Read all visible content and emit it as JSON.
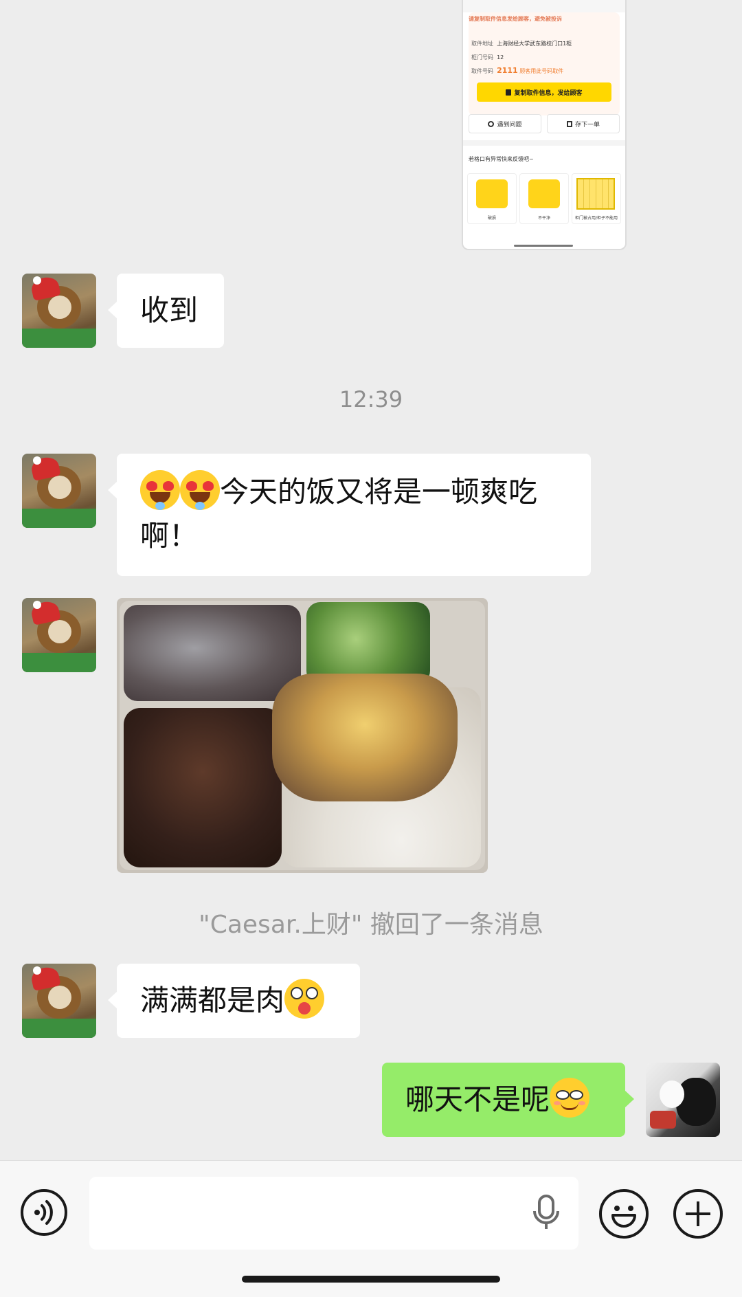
{
  "shared_screenshot": {
    "notice": "请复制取件信息发给顾客，避免被投诉",
    "address_label": "取件地址",
    "address_value": "上海财经大学武东路校门口1柜",
    "locker_label": "柜门号码",
    "locker_value": "12",
    "code_label": "取件号码",
    "code_value": "2111",
    "code_hint": "顾客用此号码取件",
    "copy_button": "复制取件信息，发给顾客",
    "problem_button": "遇到问题",
    "next_button": "存下一单",
    "feedback_title": "若格口有异常快来反馈吧~",
    "card_1": "破损",
    "card_2": "不干净",
    "card_3": "柜门被占用/柜子不能用"
  },
  "messages": {
    "m1": "收到",
    "time": "12:39",
    "m2_text": "今天的饭又将是一顿爽吃啊！",
    "recall": "\"Caesar.上财\" 撤回了一条消息",
    "m3_text": "满满都是肉",
    "m4_text": "哪天不是呢"
  },
  "icons": {
    "voice": "voice-icon",
    "mic": "mic-icon",
    "emoji": "emoji-icon",
    "plus": "plus-icon"
  },
  "colors": {
    "background": "#ededed",
    "self_bubble": "#95ec69",
    "other_bubble": "#ffffff"
  }
}
